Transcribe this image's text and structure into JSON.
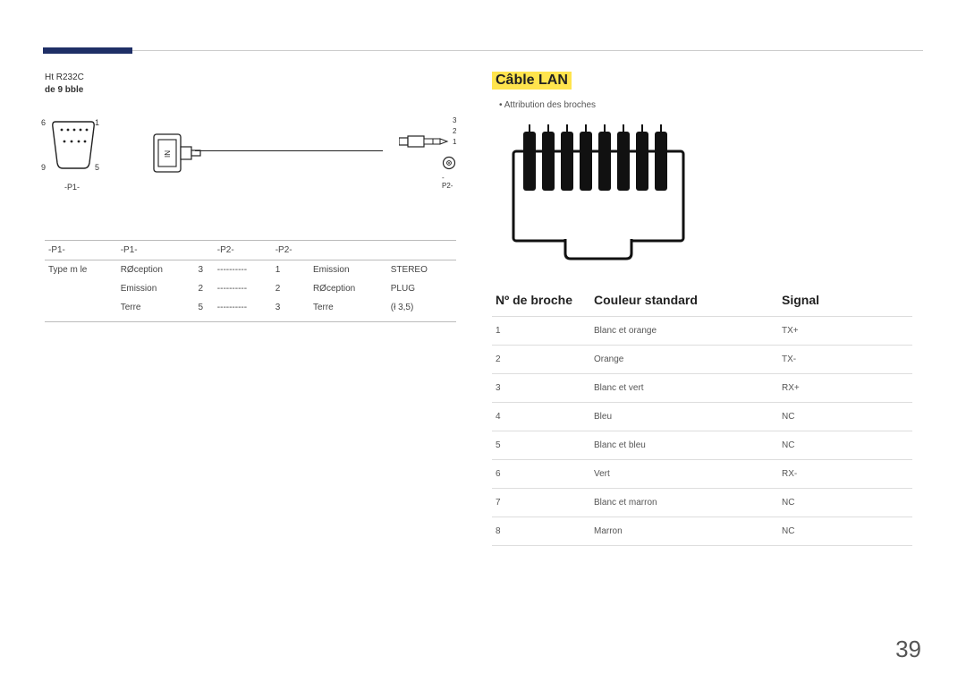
{
  "left": {
    "note_line1": "Ht  R232C",
    "note_line2": "de 9  bble",
    "pins": {
      "l6": "6",
      "l1": "1",
      "l9": "9",
      "l5": "5"
    },
    "label_p1": "-P1-",
    "jack_labels": {
      "j3": "3",
      "j2": "2",
      "j1": "1"
    },
    "label_p2": "-P2-",
    "table_header": {
      "c1": "-P1-",
      "c2": "-P1-",
      "c3": "",
      "c4": "-P2-",
      "c5": "-P2-",
      "c6": "",
      "c7": ""
    },
    "rows": [
      {
        "c1": "Type m le",
        "c2": "RØception",
        "c3": "3",
        "c4": "----------",
        "c5": "1",
        "c6": "Emission",
        "c7": "STEREO"
      },
      {
        "c1": "",
        "c2": "Emission",
        "c3": "2",
        "c4": "----------",
        "c5": "2",
        "c6": "RØception",
        "c7": "PLUG"
      },
      {
        "c1": "",
        "c2": "Terre",
        "c3": "5",
        "c4": "----------",
        "c5": "3",
        "c6": "Terre",
        "c7": "(ł 3,5)"
      }
    ]
  },
  "right": {
    "title": "Câble LAN",
    "bullet": "Attribution des broches",
    "headers": {
      "h1": "Nº de broche",
      "h2": "Couleur standard",
      "h3": "Signal"
    },
    "rows": [
      {
        "n": "1",
        "color": "Blanc et orange",
        "sig": "TX+"
      },
      {
        "n": "2",
        "color": "Orange",
        "sig": "TX-"
      },
      {
        "n": "3",
        "color": "Blanc et vert",
        "sig": "RX+"
      },
      {
        "n": "4",
        "color": "Bleu",
        "sig": "NC"
      },
      {
        "n": "5",
        "color": "Blanc et bleu",
        "sig": "NC"
      },
      {
        "n": "6",
        "color": "Vert",
        "sig": "RX-"
      },
      {
        "n": "7",
        "color": "Blanc et marron",
        "sig": "NC"
      },
      {
        "n": "8",
        "color": "Marron",
        "sig": "NC"
      }
    ]
  },
  "page_number": "39"
}
